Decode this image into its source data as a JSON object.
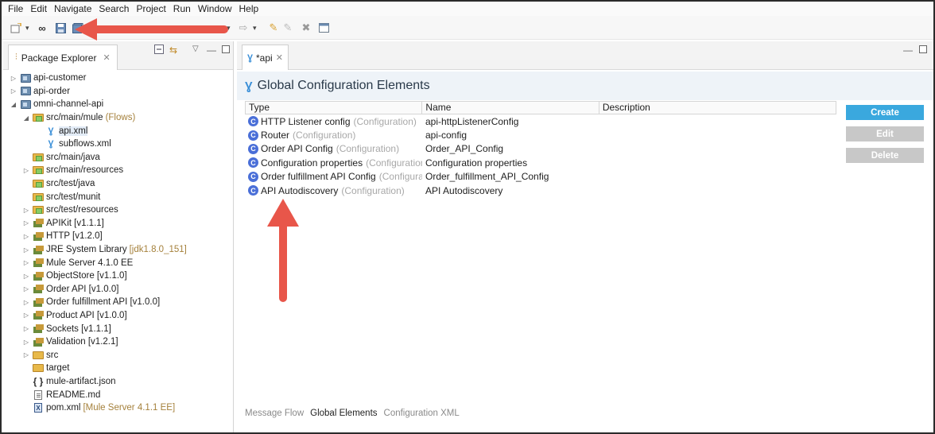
{
  "menu": [
    "File",
    "Edit",
    "Navigate",
    "Search",
    "Project",
    "Run",
    "Window",
    "Help"
  ],
  "package_explorer": {
    "tab_label": "Package Explorer",
    "items": [
      {
        "label": "api-customer",
        "suffix": "",
        "indent": 0,
        "twisty": "▷",
        "icon": "project"
      },
      {
        "label": "api-order",
        "suffix": "",
        "indent": 0,
        "twisty": "▷",
        "icon": "project"
      },
      {
        "label": "omni-channel-api",
        "suffix": "",
        "indent": 0,
        "twisty": "◢",
        "icon": "project"
      },
      {
        "label": "src/main/mule",
        "suffix": "(Flows)",
        "indent": 1,
        "twisty": "◢",
        "icon": "folder"
      },
      {
        "label": "api.xml",
        "suffix": "",
        "indent": 2,
        "twisty": "",
        "icon": "mule",
        "selected": true
      },
      {
        "label": "subflows.xml",
        "suffix": "",
        "indent": 2,
        "twisty": "",
        "icon": "mule"
      },
      {
        "label": "src/main/java",
        "suffix": "",
        "indent": 1,
        "twisty": "",
        "icon": "folder"
      },
      {
        "label": "src/main/resources",
        "suffix": "",
        "indent": 1,
        "twisty": "▷",
        "icon": "folder"
      },
      {
        "label": "src/test/java",
        "suffix": "",
        "indent": 1,
        "twisty": "",
        "icon": "folder"
      },
      {
        "label": "src/test/munit",
        "suffix": "",
        "indent": 1,
        "twisty": "",
        "icon": "folder"
      },
      {
        "label": "src/test/resources",
        "suffix": "",
        "indent": 1,
        "twisty": "▷",
        "icon": "folder"
      },
      {
        "label": "APIKit [v1.1.1]",
        "suffix": "",
        "indent": 1,
        "twisty": "▷",
        "icon": "lib"
      },
      {
        "label": "HTTP [v1.2.0]",
        "suffix": "",
        "indent": 1,
        "twisty": "▷",
        "icon": "lib"
      },
      {
        "label": "JRE System Library",
        "suffix": "[jdk1.8.0_151]",
        "indent": 1,
        "twisty": "▷",
        "icon": "lib"
      },
      {
        "label": "Mule Server 4.1.0 EE",
        "suffix": "",
        "indent": 1,
        "twisty": "▷",
        "icon": "lib"
      },
      {
        "label": "ObjectStore [v1.1.0]",
        "suffix": "",
        "indent": 1,
        "twisty": "▷",
        "icon": "lib"
      },
      {
        "label": "Order API [v1.0.0]",
        "suffix": "",
        "indent": 1,
        "twisty": "▷",
        "icon": "lib"
      },
      {
        "label": "Order fulfillment API [v1.0.0]",
        "suffix": "",
        "indent": 1,
        "twisty": "▷",
        "icon": "lib"
      },
      {
        "label": "Product API [v1.0.0]",
        "suffix": "",
        "indent": 1,
        "twisty": "▷",
        "icon": "lib"
      },
      {
        "label": "Sockets [v1.1.1]",
        "suffix": "",
        "indent": 1,
        "twisty": "▷",
        "icon": "lib"
      },
      {
        "label": "Validation [v1.2.1]",
        "suffix": "",
        "indent": 1,
        "twisty": "▷",
        "icon": "lib"
      },
      {
        "label": "src",
        "suffix": "",
        "indent": 1,
        "twisty": "▷",
        "icon": "plainfolder"
      },
      {
        "label": "target",
        "suffix": "",
        "indent": 1,
        "twisty": "",
        "icon": "plainfolder"
      },
      {
        "label": "mule-artifact.json",
        "suffix": "",
        "indent": 1,
        "twisty": "",
        "icon": "json"
      },
      {
        "label": "README.md",
        "suffix": "",
        "indent": 1,
        "twisty": "",
        "icon": "file"
      },
      {
        "label": "pom.xml",
        "suffix": "[Mule Server 4.1.1 EE]",
        "indent": 1,
        "twisty": "",
        "icon": "xml"
      }
    ]
  },
  "editor": {
    "tab_label": "*api",
    "header_title": "Global Configuration Elements",
    "columns": [
      "Type",
      "Name",
      "Description"
    ],
    "rows": [
      {
        "type": "HTTP Listener config",
        "category": "(Configuration)",
        "name": "api-httpListenerConfig",
        "description": ""
      },
      {
        "type": "Router",
        "category": "(Configuration)",
        "name": "api-config",
        "description": ""
      },
      {
        "type": "Order API Config",
        "category": "(Configuration)",
        "name": "Order_API_Config",
        "description": ""
      },
      {
        "type": "Configuration properties",
        "category": "(Configuration)",
        "name": "Configuration properties",
        "description": ""
      },
      {
        "type": "Order fulfillment API Config",
        "category": "(Configurati",
        "name": "Order_fulfillment_API_Config",
        "description": ""
      },
      {
        "type": "API Autodiscovery",
        "category": "(Configuration)",
        "name": "API Autodiscovery",
        "description": ""
      }
    ],
    "buttons": {
      "create": "Create",
      "edit": "Edit",
      "delete": "Delete"
    },
    "bottom_tabs": [
      "Message Flow",
      "Global Elements",
      "Configuration XML"
    ],
    "active_bottom_tab": "Global Elements"
  },
  "colors": {
    "annotation_arrow": "#e8564a",
    "create_button": "#3aa8de",
    "header_bg": "#eef3f8"
  }
}
